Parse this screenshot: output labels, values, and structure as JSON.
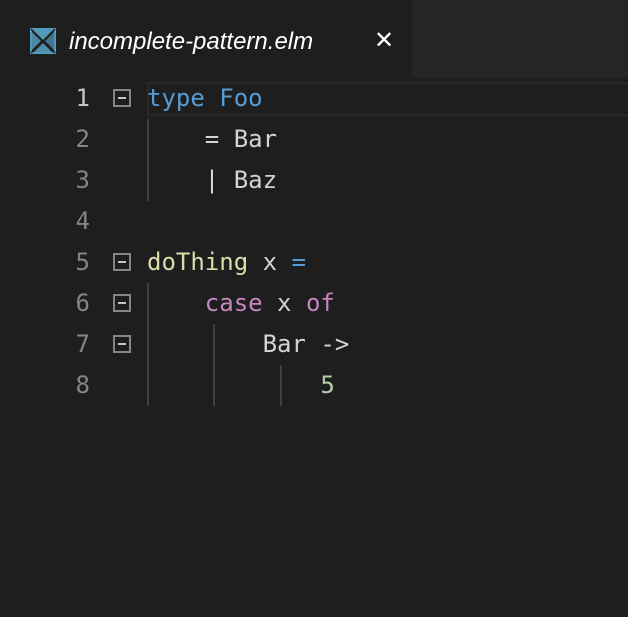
{
  "tab": {
    "title": "incomplete-pattern.elm",
    "close_glyph": "✕",
    "icon": "elm-file-icon"
  },
  "colors": {
    "background": "#1e1e1e",
    "keyword": "#569cd6",
    "function": "#dcdcaa",
    "control": "#c586c0",
    "number": "#b5cea8",
    "text": "#d4d4d4",
    "line_number": "#858585"
  },
  "editor": {
    "active_line": 1,
    "lines": [
      {
        "number": "1",
        "tokens": [
          "type",
          " ",
          "Foo"
        ]
      },
      {
        "number": "2",
        "tokens": [
          "    = Bar"
        ]
      },
      {
        "number": "3",
        "tokens": [
          "    | Baz"
        ]
      },
      {
        "number": "4",
        "tokens": [
          ""
        ]
      },
      {
        "number": "5",
        "tokens": [
          "doThing",
          " x ",
          "="
        ]
      },
      {
        "number": "6",
        "tokens": [
          "    ",
          "case",
          " x ",
          "of"
        ]
      },
      {
        "number": "7",
        "tokens": [
          "        Bar ->"
        ]
      },
      {
        "number": "8",
        "tokens": [
          "            ",
          "5"
        ]
      }
    ]
  }
}
